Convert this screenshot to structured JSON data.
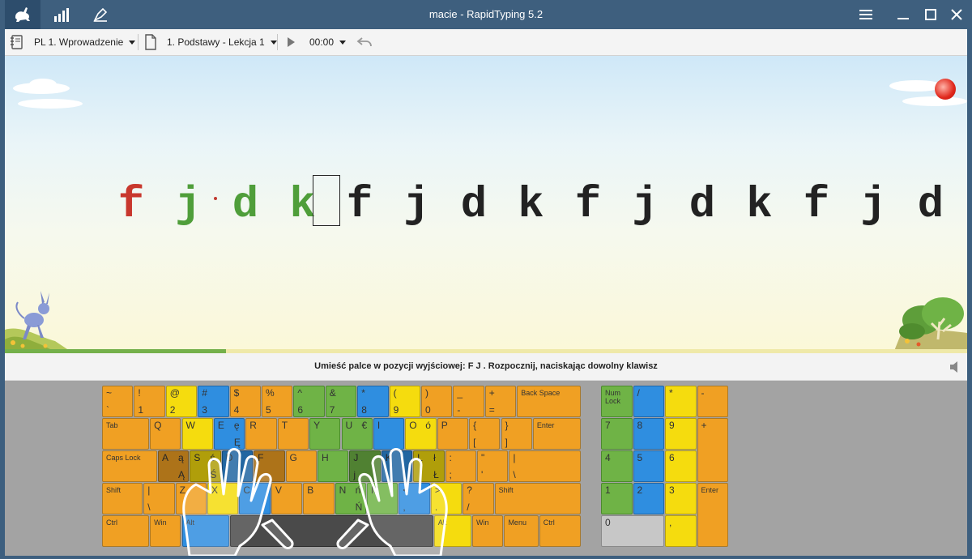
{
  "window": {
    "title": "macie - RapidTyping 5.2"
  },
  "top_tabs": [
    {
      "name": "lesson-tab-icon",
      "active": true
    },
    {
      "name": "statistics-tab-icon",
      "active": false
    },
    {
      "name": "editor-tab-icon",
      "active": false
    }
  ],
  "window_controls": {
    "menu": "☰",
    "minimize": "‒",
    "maximize": "☐",
    "close": "✕"
  },
  "toolbar": {
    "course": "PL 1. Wprowadzenie",
    "lesson": "1. Podstawy - Lekcja 1",
    "time": "00:00"
  },
  "exercise": {
    "chars": [
      {
        "c": "f",
        "state": "error"
      },
      {
        "c": "j",
        "state": "done"
      },
      {
        "c": "d",
        "state": "done"
      },
      {
        "c": "k",
        "state": "done"
      },
      {
        "c": "f",
        "state": "current"
      },
      {
        "c": "j",
        "state": "todo"
      },
      {
        "c": "d",
        "state": "todo"
      },
      {
        "c": "k",
        "state": "todo"
      },
      {
        "c": "f",
        "state": "todo"
      },
      {
        "c": "j",
        "state": "todo"
      },
      {
        "c": "d",
        "state": "todo"
      },
      {
        "c": "k",
        "state": "todo"
      },
      {
        "c": "f",
        "state": "todo"
      },
      {
        "c": "j",
        "state": "todo"
      },
      {
        "c": "d",
        "state": "todo"
      }
    ],
    "colors": {
      "error": "#c8372d",
      "done": "#4f9e3a",
      "current": "#222222",
      "todo": "#222222"
    },
    "progress": 0.23
  },
  "hint": "Umieść palce w pozycji wyjściowej:  F J .  Rozpocznij, naciskając dowolny klawisz",
  "keyboard": {
    "rows": [
      [
        {
          "t": "~",
          "b": "`",
          "c": "o"
        },
        {
          "t": "!",
          "b": "1",
          "c": "o"
        },
        {
          "t": "@",
          "b": "2",
          "c": "y"
        },
        {
          "t": "#",
          "b": "3",
          "c": "b"
        },
        {
          "t": "$",
          "b": "4",
          "c": "o"
        },
        {
          "t": "%",
          "b": "5",
          "c": "o"
        },
        {
          "t": "^",
          "b": "6",
          "c": "g"
        },
        {
          "t": "&",
          "b": "7",
          "c": "g"
        },
        {
          "t": "*",
          "b": "8",
          "c": "b"
        },
        {
          "t": "(",
          "b": "9",
          "c": "y"
        },
        {
          "t": ")",
          "b": "0",
          "c": "o"
        },
        {
          "t": "_",
          "b": "-",
          "c": "o"
        },
        {
          "t": "+",
          "b": "=",
          "c": "o"
        },
        {
          "lbl": "Back Space",
          "c": "o"
        }
      ],
      [
        {
          "lbl": "Tab",
          "c": "o"
        },
        {
          "t": "Q",
          "c": "o"
        },
        {
          "t": "W",
          "c": "y"
        },
        {
          "t": "E",
          "t2": "ę",
          "b2": "Ę",
          "c": "b"
        },
        {
          "t": "R",
          "c": "o"
        },
        {
          "t": "T",
          "c": "o"
        },
        {
          "t": "Y",
          "c": "g"
        },
        {
          "t": "U",
          "t2": "€",
          "c": "g"
        },
        {
          "t": "I",
          "c": "b"
        },
        {
          "t": "O",
          "t2": "ó",
          "c": "y"
        },
        {
          "t": "P",
          "c": "o"
        },
        {
          "t": "{",
          "b": "[",
          "c": "o"
        },
        {
          "t": "}",
          "b": "]",
          "c": "o"
        },
        {
          "lbl": "Enter",
          "c": "o"
        }
      ],
      [
        {
          "lbl": "Caps Lock",
          "c": "o"
        },
        {
          "t": "A",
          "t2": "ą",
          "b2": "Ą",
          "c": "o"
        },
        {
          "t": "S",
          "t2": "ś",
          "b2": "Ś",
          "c": "y"
        },
        {
          "t": "D",
          "c": "b"
        },
        {
          "t": "F",
          "c": "o"
        },
        {
          "t": "G",
          "c": "o"
        },
        {
          "t": "H",
          "c": "g"
        },
        {
          "t": "J",
          "b": "j",
          "c": "g"
        },
        {
          "t": "K",
          "c": "b"
        },
        {
          "t": "L",
          "t2": "ł",
          "b2": "Ł",
          "c": "y"
        },
        {
          "t": ":",
          "b": ";",
          "c": "o"
        },
        {
          "t": "\"",
          "b": "'",
          "c": "o"
        },
        {
          "t": "|",
          "b": "\\",
          "c": "o"
        }
      ],
      [
        {
          "lbl": "Shift",
          "c": "o"
        },
        {
          "t": "|",
          "b": "\\",
          "c": "o"
        },
        {
          "t": "Z",
          "c": "o"
        },
        {
          "t": "X",
          "c": "y"
        },
        {
          "t": "C",
          "c": "b"
        },
        {
          "t": "V",
          "c": "o"
        },
        {
          "t": "B",
          "c": "o"
        },
        {
          "t": "N",
          "t2": "ń",
          "b2": "Ń",
          "c": "g"
        },
        {
          "t": "M",
          "c": "g"
        },
        {
          "t": "<",
          "b": ",",
          "c": "b"
        },
        {
          "t": ">",
          "b": ".",
          "c": "y"
        },
        {
          "t": "?",
          "b": "/",
          "c": "o"
        },
        {
          "lbl": "Shift",
          "c": "o"
        }
      ],
      [
        {
          "lbl": "Ctrl",
          "c": "o"
        },
        {
          "lbl": "Win",
          "c": "o"
        },
        {
          "lbl": "Alt",
          "c": "b"
        },
        {
          "lbl": "",
          "c": "sp"
        },
        {
          "lbl": "Alt",
          "c": "y"
        },
        {
          "lbl": "Win",
          "c": "o"
        },
        {
          "lbl": "Menu",
          "c": "o"
        },
        {
          "lbl": "Ctrl",
          "c": "o"
        }
      ]
    ],
    "numpad": [
      {
        "lbl": "Num Lock",
        "c": "g"
      },
      {
        "t": "/",
        "c": "b"
      },
      {
        "t": "*",
        "c": "y"
      },
      {
        "t": "-",
        "c": "o"
      },
      {
        "t": "7",
        "c": "g"
      },
      {
        "t": "8",
        "c": "b"
      },
      {
        "t": "9",
        "c": "y"
      },
      {
        "t": "+",
        "c": "o"
      },
      {
        "t": "4",
        "c": "g"
      },
      {
        "t": "5",
        "c": "b"
      },
      {
        "t": "6",
        "c": "y"
      },
      {
        "t": "1",
        "c": "g"
      },
      {
        "t": "2",
        "c": "b"
      },
      {
        "t": "3",
        "c": "y"
      },
      {
        "lbl": "Enter",
        "c": "o"
      },
      {
        "t": "0",
        "c": "gr"
      },
      {
        "t": ",",
        "c": "y"
      }
    ]
  }
}
